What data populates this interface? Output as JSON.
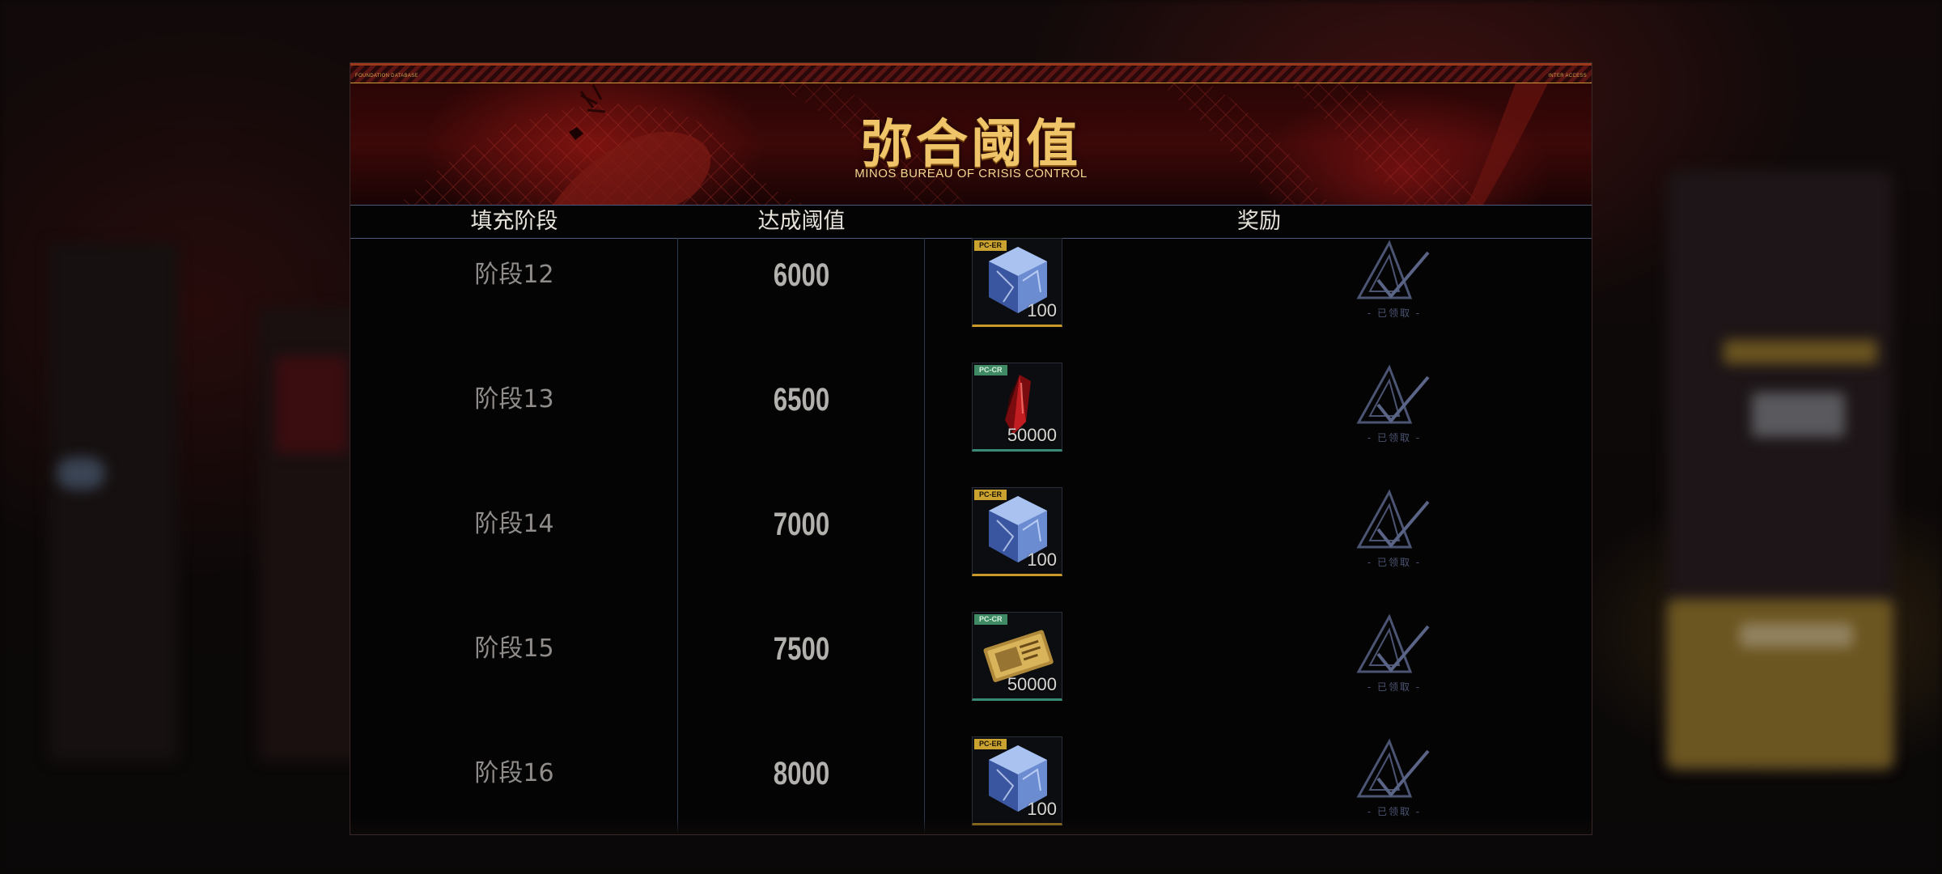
{
  "panel": {
    "top_meta_left": "FOUNDATION DATABASE",
    "top_meta_right": "INTER ACCESS",
    "title_cn": "弥合阈值",
    "title_en": "MINOS BUREAU OF CRISIS CONTROL"
  },
  "table": {
    "headers": {
      "stage": "填充阶段",
      "threshold": "达成阈值",
      "reward": "奖励"
    },
    "rows": [
      {
        "stage": "阶段12",
        "threshold": "6000",
        "item_tag": "PC-ER",
        "item_quantity": "100",
        "item_icon": "blue-crystal-cube-icon",
        "item_rarity": "gold",
        "status": "- 已领取 -"
      },
      {
        "stage": "阶段13",
        "threshold": "6500",
        "item_tag": "PC-CR",
        "item_quantity": "50000",
        "item_icon": "red-shard-icon",
        "item_rarity": "teal",
        "status": "- 已领取 -"
      },
      {
        "stage": "阶段14",
        "threshold": "7000",
        "item_tag": "PC-ER",
        "item_quantity": "100",
        "item_icon": "blue-crystal-cube-icon",
        "item_rarity": "gold",
        "status": "- 已领取 -"
      },
      {
        "stage": "阶段15",
        "threshold": "7500",
        "item_tag": "PC-CR",
        "item_quantity": "50000",
        "item_icon": "gold-ticket-icon",
        "item_rarity": "teal",
        "status": "- 已领取 -"
      },
      {
        "stage": "阶段16",
        "threshold": "8000",
        "item_tag": "PC-ER",
        "item_quantity": "100",
        "item_icon": "blue-crystal-cube-icon",
        "item_rarity": "gold",
        "status": "- 已领取 -"
      }
    ]
  },
  "colors": {
    "accent_gold": "#f0c468",
    "banner_red": "#3c0808",
    "claimed_mark": "#4b5472"
  }
}
